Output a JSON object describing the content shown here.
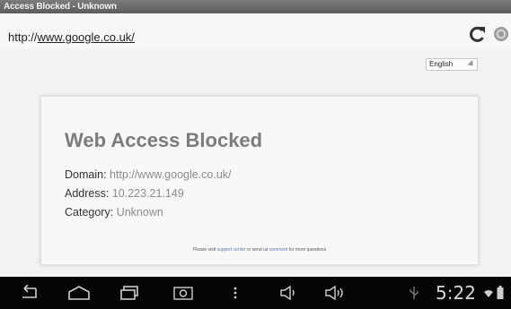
{
  "window": {
    "title": "Access Blocked - Unknown"
  },
  "address_bar": {
    "url_prefix": "http://",
    "url_host": "www.google.co.uk/"
  },
  "language_select": {
    "selected": "English"
  },
  "card": {
    "heading": "Web Access Blocked",
    "domain_label": "Domain:",
    "domain_value": "http://www.google.co.uk/",
    "address_label": "Address:",
    "address_value": "10.223.21.149",
    "category_label": "Category:",
    "category_value": "Unknown",
    "footer_prefix": "Please visit",
    "footer_link1": "support center",
    "footer_mid": "or send us",
    "footer_link2": "comment",
    "footer_suffix": "for more questions"
  },
  "status_bar": {
    "time": "5:22"
  },
  "icons": {
    "reload": "reload-icon",
    "settings": "settings-gear-icon",
    "back": "back-icon",
    "home": "home-icon",
    "recents": "recent-apps-icon",
    "screenshot": "screenshot-icon",
    "menu": "menu-icon",
    "vol_down": "volume-down-icon",
    "vol_up": "volume-up-icon",
    "usb": "usb-icon",
    "wifi": "wifi-icon",
    "battery": "battery-icon"
  },
  "colors": {
    "heading": "#7c7c7c",
    "link": "#5b7ab3",
    "navbar": "#050505"
  }
}
